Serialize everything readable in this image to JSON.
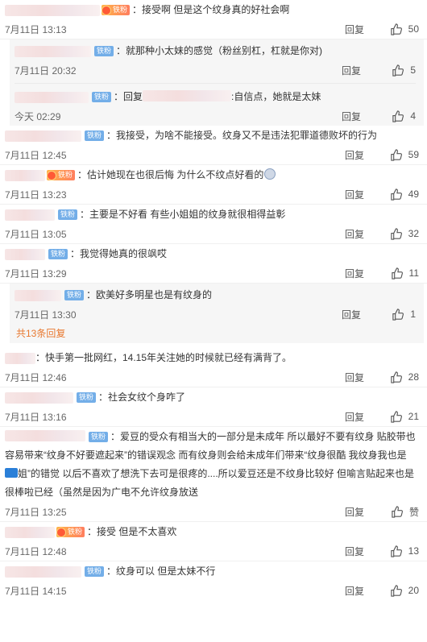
{
  "like_icon": "thumbs-up-icon",
  "reply_label": "回复",
  "comments": [
    {
      "blur_w": 118,
      "badge": "gold",
      "badge_label": "铁粉",
      "text": "：接受啊 但是这个纹身真的好社会啊",
      "time": "7月11日 13:13",
      "likes": "50"
    },
    {
      "blur_w": 95,
      "badge": "fan",
      "badge_label": "铁粉",
      "text": "：我接受，为啥不能接受。纹身又不是违法犯罪道德败坏的行为",
      "time": "7月11日 12:45",
      "likes": "59"
    },
    {
      "blur_w": 50,
      "badge": "gold",
      "badge_label": "铁粉",
      "text": "：估计她现在也很后悔 为什么不纹点好看的",
      "time": "7月11日 13:23",
      "likes": "49"
    },
    {
      "blur_w": 62,
      "badge": "fan",
      "badge_label": "铁粉",
      "text": "：主要是不好看    有些小姐姐的纹身就很相得益彰",
      "time": "7月11日 13:05",
      "likes": "32"
    },
    {
      "blur_w": 50,
      "badge": "fan",
      "badge_label": "铁粉",
      "text": "：我觉得她真的很飒哎",
      "time": "7月11日 13:29",
      "likes": "11"
    },
    {
      "blur_w": 38,
      "badge": "",
      "badge_label": "",
      "text": "：快手第一批网红，14.15年关注她的时候就已经有满背了。",
      "time": "7月11日 12:46",
      "likes": "28"
    },
    {
      "blur_w": 85,
      "badge": "fan",
      "badge_label": "铁粉",
      "text": "：社会女纹个身咋了",
      "time": "7月11日 13:16",
      "likes": "21"
    },
    {
      "blur_w": 100,
      "badge": "fan",
      "badge_label": "铁粉",
      "text": "：爱豆的受众有相当大的一部分是未成年 所以最好不要有纹身 贴胶带也容易带来“纹身不好要遮起来”的错误观念 而有纹身则会给未成年们带来“纹身很酷 我纹身我也是",
      "text_tail": "姐”的错觉 以后不喜欢了想洗下去可是很疼的....所以爱豆还是不纹身比较好 但喻言贴起来也是很棒啦已经（虽然是因为广电不允许纹身放送",
      "time": "7月11日 13:25",
      "likes": "赞"
    },
    {
      "blur_w": 62,
      "badge": "gold",
      "badge_label": "铁粉",
      "text": "：接受  但是不太喜欢",
      "time": "7月11日 12:48",
      "likes": "13"
    },
    {
      "blur_w": 95,
      "badge": "fan",
      "badge_label": "铁粉",
      "text": "：纹身可以 但是太妹不行",
      "time": "7月11日 14:15",
      "likes": "20"
    }
  ],
  "replies_a": [
    {
      "blur_w": 95,
      "badge_label": "铁粉",
      "text": "：就那种小太妹的感觉（粉丝别杠，杠就是你对)",
      "time": "7月11日 20:32",
      "likes": "5"
    },
    {
      "blur_w": 92,
      "badge_label": "铁粉",
      "pre": "：回复",
      "post": ":自信点，她就是太妹",
      "time": "今天 02:29",
      "likes": "4"
    }
  ],
  "replies_b": [
    {
      "blur_w": 58,
      "badge_label": "铁粉",
      "text": "：欧美好多明星也是有纹身的",
      "time": "7月11日 13:30",
      "likes": "1"
    }
  ],
  "more_replies": "共13条回复"
}
